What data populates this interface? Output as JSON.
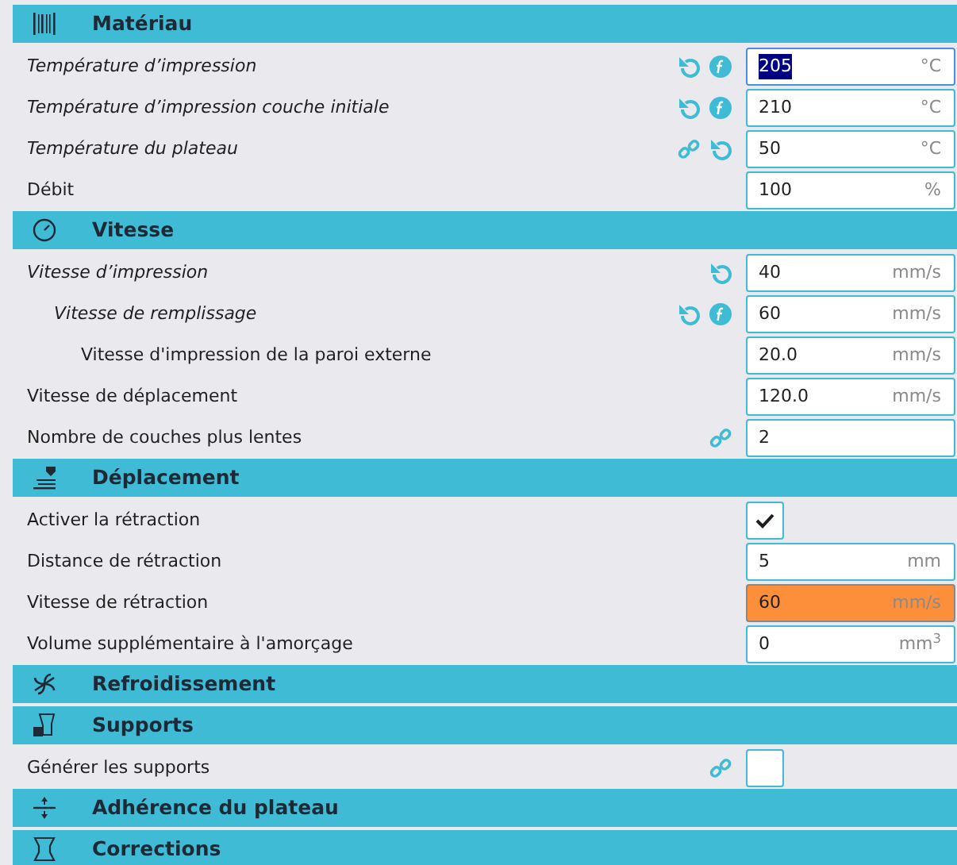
{
  "categories": [
    {
      "title": "Matériau",
      "rows": [
        {
          "label": "Température d’impression",
          "modified": true,
          "icons": [
            {
              "kind": "reset"
            },
            {
              "kind": "formula"
            }
          ],
          "kind": "number",
          "value": "205",
          "unit": "°C",
          "selected": true,
          "warning": false
        },
        {
          "label": "Température d’impression couche initiale",
          "modified": true,
          "icons": [
            {
              "kind": "reset"
            },
            {
              "kind": "formula"
            }
          ],
          "kind": "number",
          "value": "210",
          "unit": "°C",
          "selected": false,
          "warning": false
        },
        {
          "label": "Température du plateau",
          "modified": true,
          "icons": [
            {
              "kind": "link"
            },
            {
              "kind": "reset"
            }
          ],
          "kind": "number",
          "value": "50",
          "unit": "°C",
          "selected": false,
          "warning": false
        },
        {
          "label": "Débit",
          "modified": false,
          "kind": "number",
          "value": "100",
          "unit": "%",
          "selected": false,
          "warning": false
        }
      ]
    },
    {
      "title": "Vitesse",
      "rows": [
        {
          "label": "Vitesse d’impression",
          "modified": true,
          "icons": [
            {
              "kind": "reset"
            }
          ],
          "kind": "number",
          "value": "40",
          "unit": "mm/s",
          "selected": false,
          "warning": false,
          "children": [
            {
              "label": "Vitesse de remplissage",
              "modified": true,
              "icons": [
                {
                  "kind": "reset"
                },
                {
                  "kind": "formula"
                }
              ],
              "kind": "number",
              "value": "60",
              "unit": "mm/s",
              "selected": false,
              "warning": false,
              "children": [
                {
                  "label": "Vitesse d'impression de la paroi externe",
                  "modified": false,
                  "kind": "number",
                  "value": "20.0",
                  "unit": "mm/s",
                  "selected": false,
                  "warning": false
                }
              ]
            }
          ]
        },
        {
          "label": "Vitesse de déplacement",
          "modified": false,
          "kind": "number",
          "value": "120.0",
          "unit": "mm/s",
          "selected": false,
          "warning": false
        },
        {
          "label": "Nombre de couches plus lentes",
          "modified": false,
          "icons": [
            {
              "kind": "link"
            }
          ],
          "kind": "number",
          "value": "2",
          "selected": false,
          "warning": false
        }
      ]
    },
    {
      "title": "Déplacement",
      "rows": [
        {
          "label": "Activer la rétraction",
          "modified": false,
          "kind": "checkbox",
          "checked": true
        },
        {
          "label": "Distance de rétraction",
          "modified": false,
          "kind": "number",
          "value": "5",
          "unit": "mm",
          "selected": false,
          "warning": false
        },
        {
          "label": "Vitesse de rétraction",
          "modified": false,
          "kind": "number",
          "value": "60",
          "unit": "mm/s",
          "selected": false,
          "warning": true
        },
        {
          "label": "Volume supplémentaire à l'amorçage",
          "modified": false,
          "kind": "number",
          "value": "0",
          "unit": "mm$^{3}$",
          "selected": false,
          "warning": false
        }
      ]
    },
    {
      "title": "Refroidissement"
    },
    {
      "title": "Supports",
      "rows": [
        {
          "label": "Générer les supports",
          "modified": false,
          "icons": [
            {
              "kind": "link"
            }
          ],
          "kind": "checkbox",
          "checked": false
        }
      ]
    },
    {
      "title": "Adhérence du plateau"
    },
    {
      "title": "Corrections"
    }
  ]
}
